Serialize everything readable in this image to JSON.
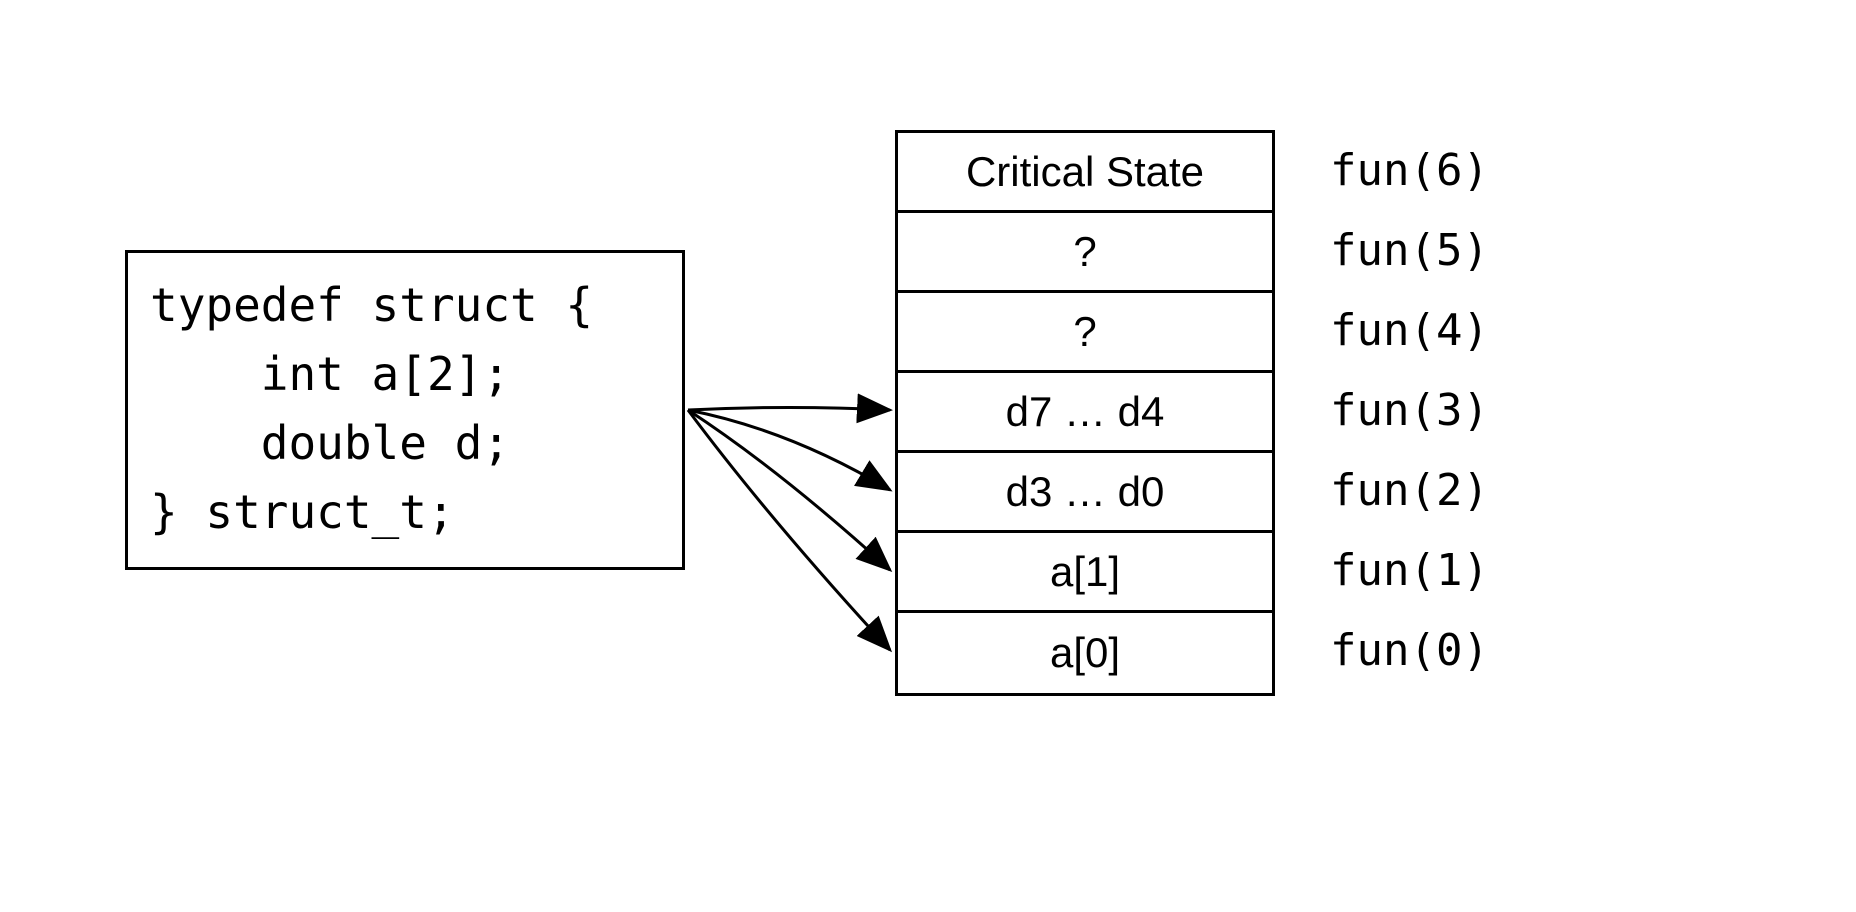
{
  "code": {
    "line1": "typedef struct {",
    "line2": "    int a[2];",
    "line3": "    double d;",
    "line4": "} struct_t;"
  },
  "stack": {
    "rows": [
      "Critical State",
      "?",
      "?",
      "d7 … d4",
      "d3 … d0",
      "a[1]",
      "a[0]"
    ]
  },
  "funs": {
    "labels": [
      "fun(6)",
      "fun(5)",
      "fun(4)",
      "fun(3)",
      "fun(2)",
      "fun(1)",
      "fun(0)"
    ]
  }
}
